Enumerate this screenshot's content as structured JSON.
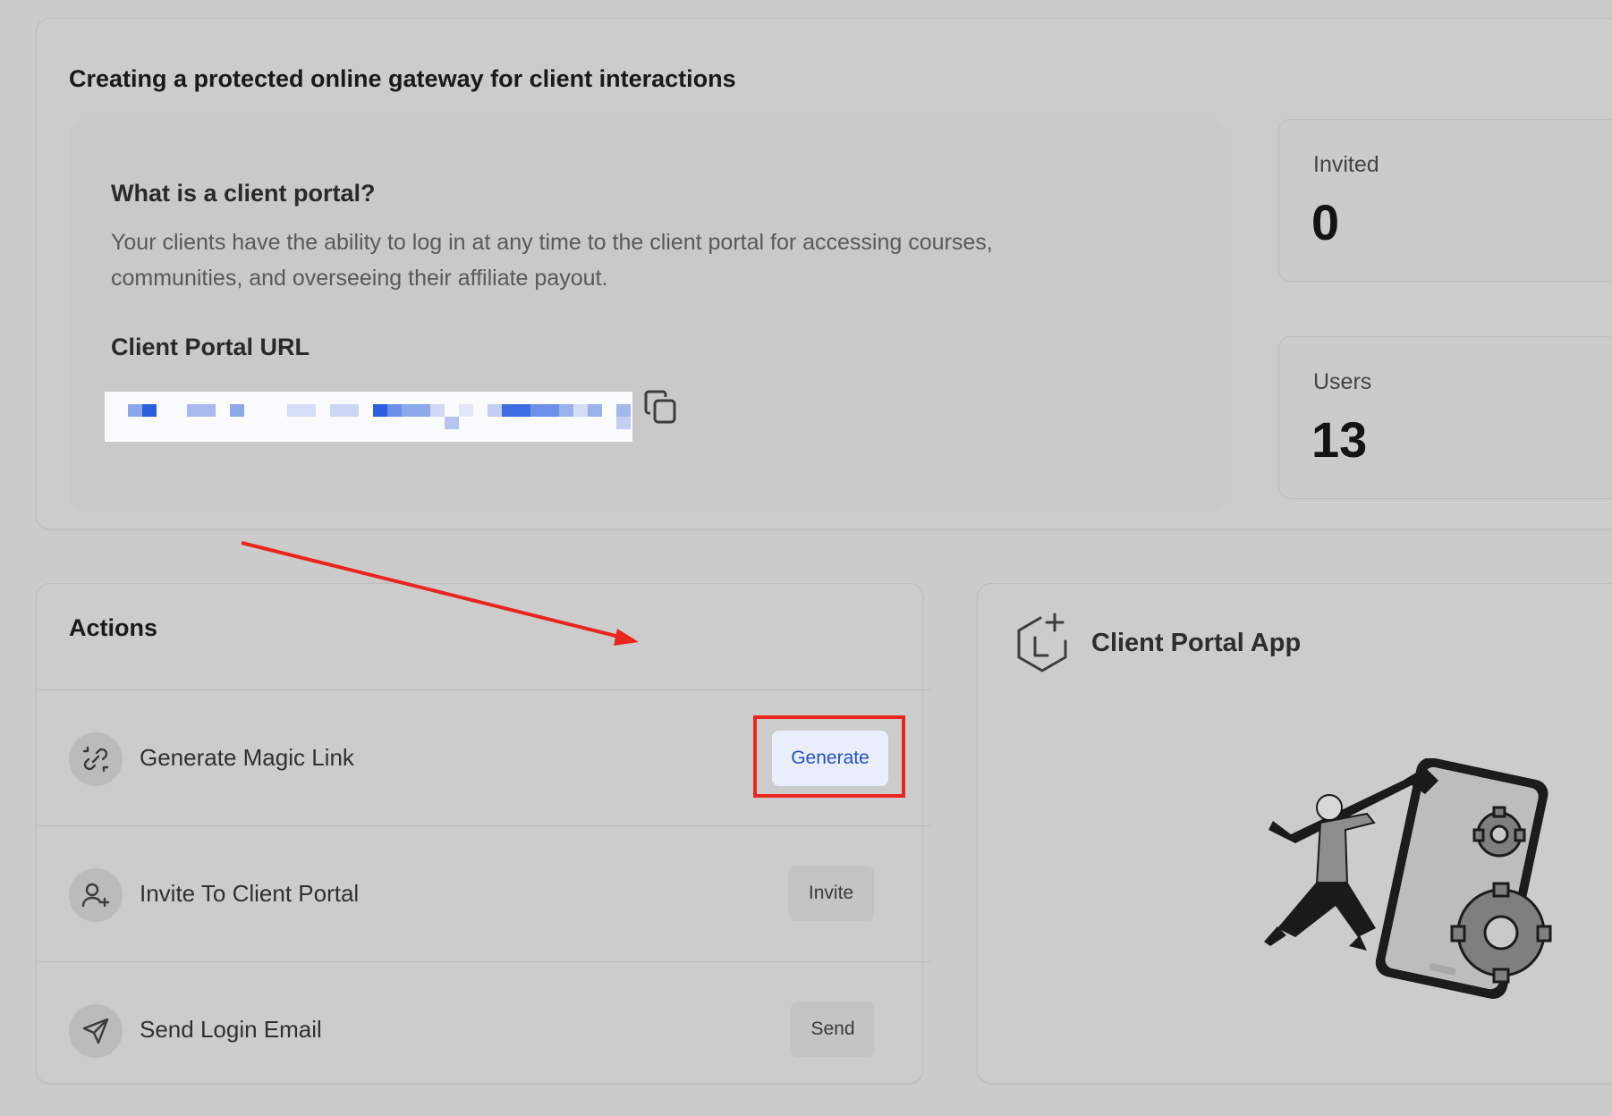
{
  "portal": {
    "title": "Creating a protected online gateway for client interactions",
    "info": {
      "heading": "What is a client portal?",
      "body": "Your clients have the ability to log in at any time to the client portal for accessing courses, communities, and overseeing their affiliate payout.",
      "url_heading": "Client Portal URL",
      "copy_icon": "copy-icon"
    },
    "stats": {
      "invited": {
        "label": "Invited",
        "value": "0"
      },
      "users": {
        "label": "Users",
        "value": "13"
      }
    }
  },
  "actions": {
    "title": "Actions",
    "items": [
      {
        "label": "Generate Magic Link",
        "button": "Generate",
        "icon": "magic-link-icon"
      },
      {
        "label": "Invite To Client Portal",
        "button": "Invite",
        "icon": "user-plus-icon"
      },
      {
        "label": "Send Login Email",
        "button": "Send",
        "icon": "paper-plane-icon"
      }
    ]
  },
  "app": {
    "title": "Client Portal App",
    "icon": "hexagon-add-icon",
    "illustration": "mechanic-with-wrench-and-gears"
  },
  "colors": {
    "annotation": "#e8261e",
    "primary_button_text": "#2251c5",
    "primary_button_bg": "#e9eefa",
    "page_bg": "#cbcbcb"
  }
}
